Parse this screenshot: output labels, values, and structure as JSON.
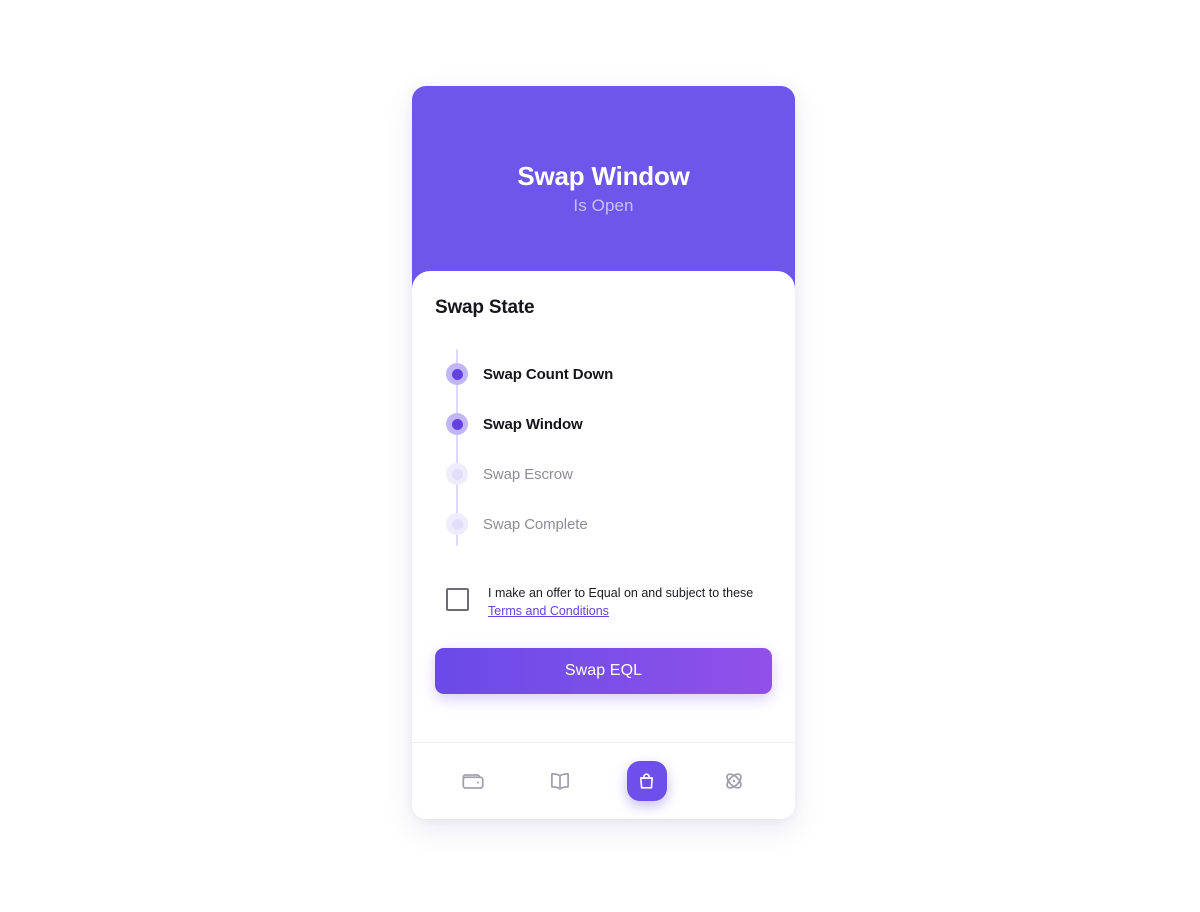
{
  "header": {
    "title": "Swap Window",
    "subtitle": "Is Open"
  },
  "content": {
    "section_title": "Swap State",
    "timeline": [
      {
        "label": "Swap Count Down",
        "state": "active"
      },
      {
        "label": "Swap Window",
        "state": "active"
      },
      {
        "label": "Swap Escrow",
        "state": "inactive"
      },
      {
        "label": "Swap Complete",
        "state": "inactive"
      }
    ],
    "terms": {
      "text_before_link": "I make an offer to Equal on and subject to these ",
      "link_label": "Terms and Conditions",
      "checked": false
    },
    "primary_button": {
      "label": "Swap EQL"
    }
  },
  "bottom_nav": {
    "items": [
      {
        "icon": "wallet-icon",
        "active": false
      },
      {
        "icon": "book-icon",
        "active": false
      },
      {
        "icon": "shopping-bag-icon",
        "active": true
      },
      {
        "icon": "atom-icon",
        "active": false
      }
    ]
  },
  "colors": {
    "header_purple": "#6d56e9",
    "accent_purple": "#6342e4",
    "timeline_track": "#ded8fb",
    "active_dot_halo": "#c3b6f6",
    "inactive_dot_halo": "#efecfd",
    "button_gradient_start": "#6a4ae8",
    "button_gradient_end": "#9150e9",
    "inactive_text": "#8d8d99",
    "nav_icon": "#a0a0b0"
  }
}
